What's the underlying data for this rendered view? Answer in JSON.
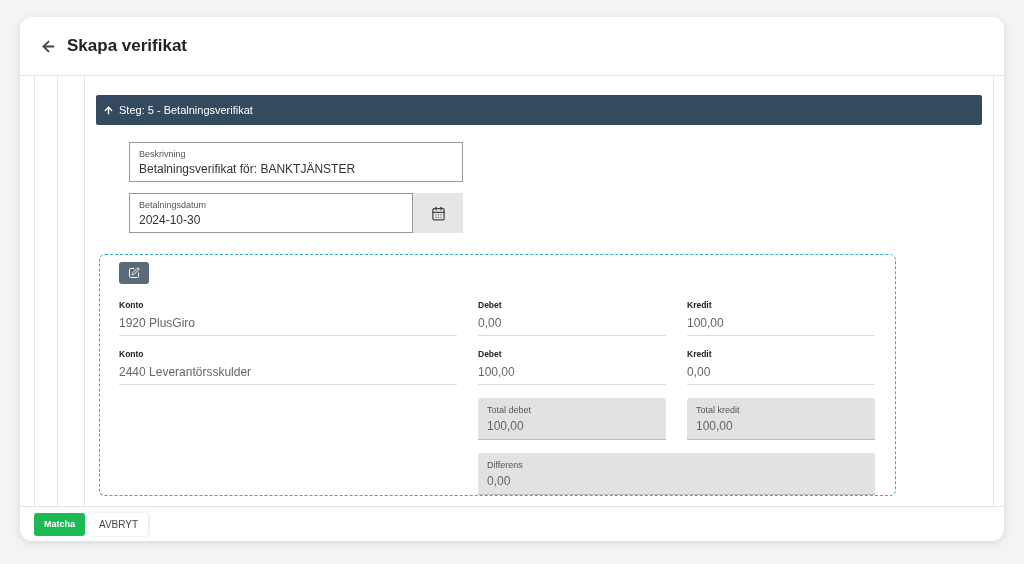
{
  "header": {
    "title": "Skapa verifikat"
  },
  "step": {
    "label": "Steg: 5 - Betalningsverifikat",
    "expanded": true
  },
  "description": {
    "label": "Beskrivning",
    "value": "Betalningsverifikat för: BANKTJÄNSTER"
  },
  "payment_date": {
    "label": "Betalningsdatum",
    "value": "2024-10-30"
  },
  "rows": [
    {
      "account_label": "Konto",
      "account": "1920 PlusGiro",
      "debit_label": "Debet",
      "debit": "0,00",
      "credit_label": "Kredit",
      "credit": "100,00"
    },
    {
      "account_label": "Konto",
      "account": "2440 Leverantörsskulder",
      "debit_label": "Debet",
      "debit": "100,00",
      "credit_label": "Kredit",
      "credit": "0,00"
    }
  ],
  "totals": {
    "debit_label": "Total debet",
    "debit": "100,00",
    "credit_label": "Total kredit",
    "credit": "100,00",
    "difference_label": "Differens",
    "difference": "0,00"
  },
  "buttons": [
    {
      "label": "Matcha",
      "kind": "primary"
    },
    {
      "label": "AVBRYT",
      "kind": "plain"
    }
  ]
}
